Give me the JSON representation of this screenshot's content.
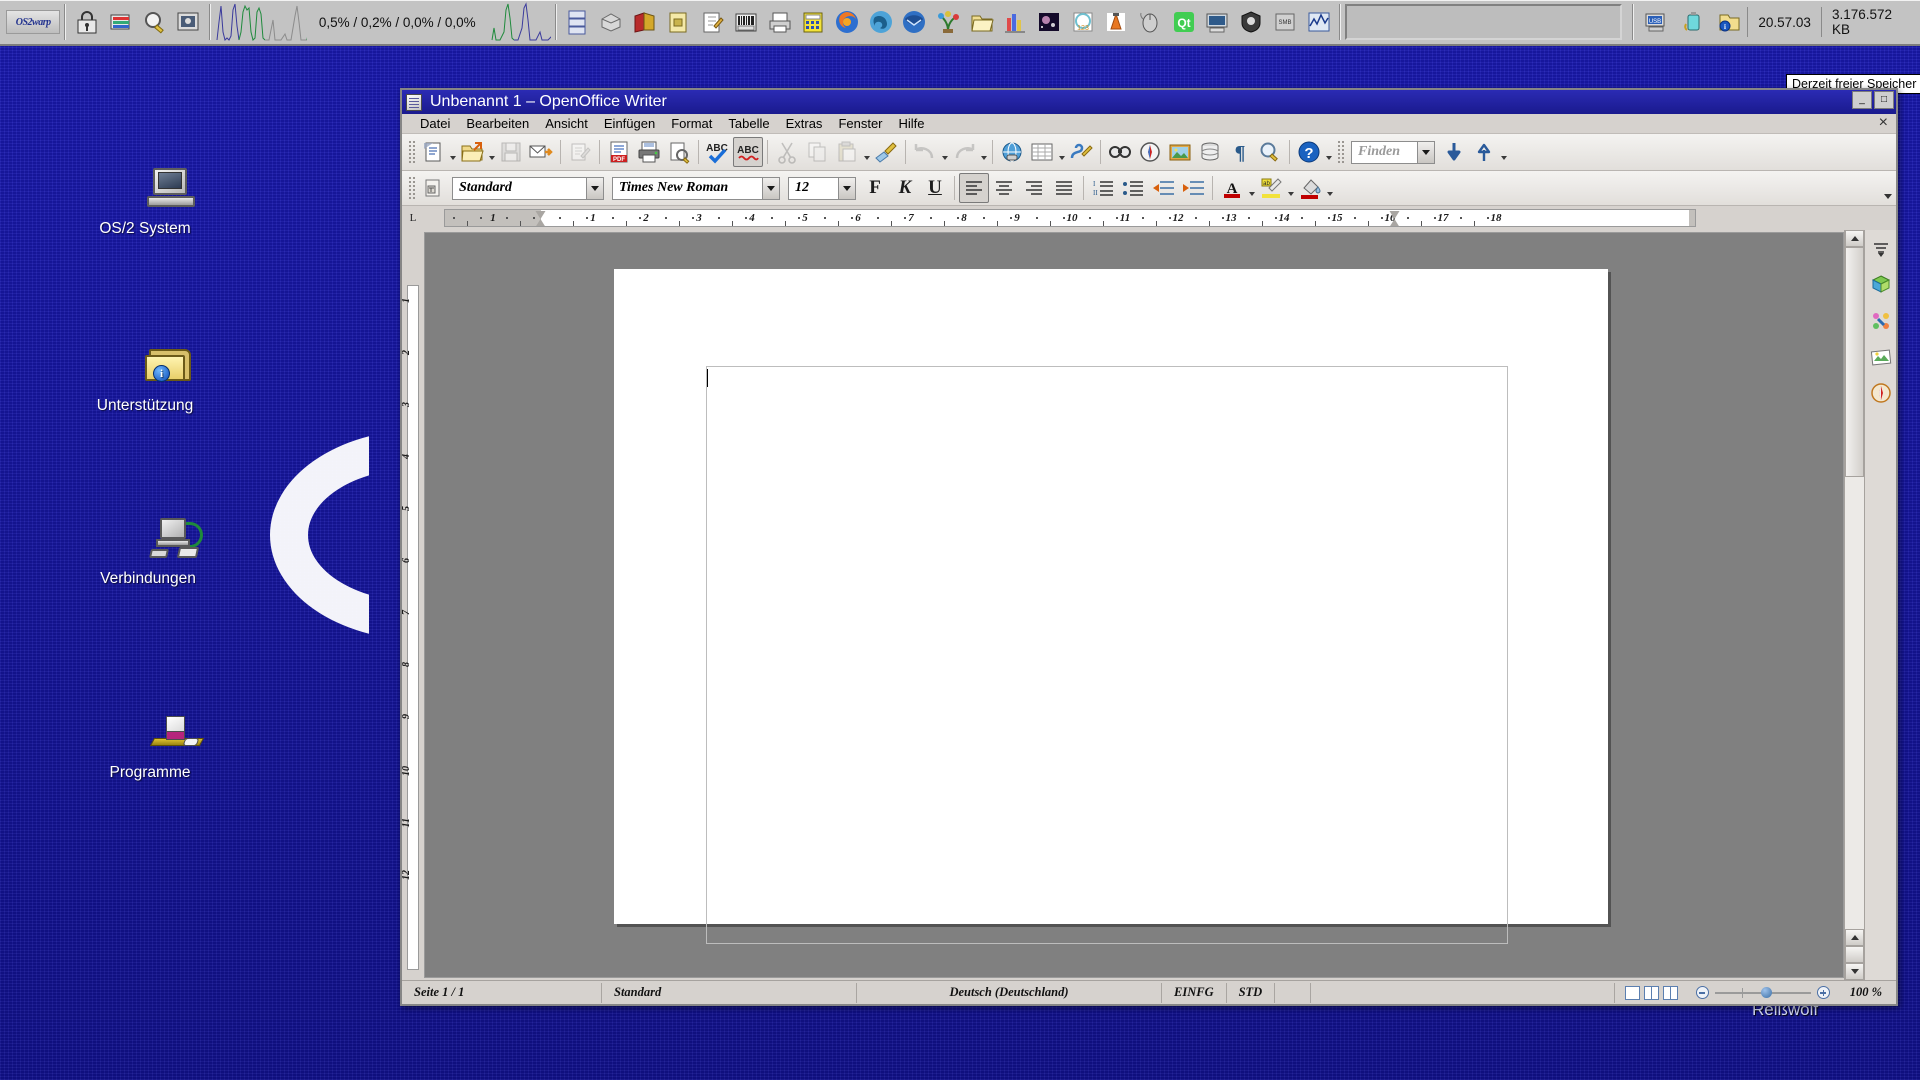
{
  "desktop": {
    "icons": [
      {
        "label": "OS/2 System",
        "icon": "computer-icon"
      },
      {
        "label": "Unterstützung",
        "icon": "folder-info-icon"
      },
      {
        "label": "Verbindungen",
        "icon": "network-icon"
      },
      {
        "label": "Programme",
        "icon": "programs-icon"
      }
    ],
    "watermark_text": "Reißwolf"
  },
  "xcenter": {
    "os2_logo": "OS2warp",
    "cpu_load": "0,5% / 0,2% / 0,0% / 0,0%",
    "clock": "20.57.03",
    "free_memory": "3.176.572 KB",
    "tooltip": "Derzeit freier Speicher",
    "left_buttons": [
      {
        "name": "lock-icon",
        "title": "Sperren"
      },
      {
        "name": "window-list-icon",
        "title": "Fensterliste"
      },
      {
        "name": "find-icon",
        "title": "Suchen"
      },
      {
        "name": "desktop-icon",
        "title": "Arbeitsoberfläche"
      }
    ],
    "launch_buttons": [
      {
        "name": "drives-icon"
      },
      {
        "name": "harddisk-icon"
      },
      {
        "name": "books-icon"
      },
      {
        "name": "notebook-icon"
      },
      {
        "name": "editor-icon"
      },
      {
        "name": "keyboard-icon"
      },
      {
        "name": "printer-icon"
      },
      {
        "name": "calculator-icon"
      },
      {
        "name": "firefox-icon"
      },
      {
        "name": "seamonkey-icon"
      },
      {
        "name": "thunderbird-icon"
      },
      {
        "name": "plant-icon"
      },
      {
        "name": "folder-open-icon"
      },
      {
        "name": "city-icon"
      },
      {
        "name": "space-icon"
      },
      {
        "name": "numbers-icon"
      },
      {
        "name": "vlc-icon"
      },
      {
        "name": "mouse-icon"
      },
      {
        "name": "qt-icon"
      },
      {
        "name": "monitor-icon"
      },
      {
        "name": "shield-icon"
      },
      {
        "name": "samba-icon"
      },
      {
        "name": "intel-icon"
      }
    ],
    "tray_buttons": [
      {
        "name": "usb-icon"
      },
      {
        "name": "battery-icon"
      },
      {
        "name": "folder-info-tray-icon"
      }
    ]
  },
  "writer": {
    "title": "Unbenannt 1 – OpenOffice Writer",
    "window_buttons": [
      "_",
      "□",
      "×"
    ],
    "menu_close": "×",
    "menu": [
      {
        "label": "Datei",
        "accel": "D"
      },
      {
        "label": "Bearbeiten",
        "accel": "B"
      },
      {
        "label": "Ansicht",
        "accel": "A"
      },
      {
        "label": "Einfügen",
        "accel": "E"
      },
      {
        "label": "Format",
        "accel": "F"
      },
      {
        "label": "Tabelle",
        "accel": "T"
      },
      {
        "label": "Extras",
        "accel": "x"
      },
      {
        "label": "Fenster",
        "accel": "s"
      },
      {
        "label": "Hilfe",
        "accel": "H"
      }
    ],
    "standard_toolbar": [
      {
        "name": "new-document-button",
        "label": "Neu",
        "dropdown": true,
        "disabled": false
      },
      {
        "name": "open-document-button",
        "label": "Öffnen",
        "dropdown": true,
        "disabled": false
      },
      {
        "name": "save-button",
        "label": "Speichern",
        "disabled": true
      },
      {
        "name": "send-email-button",
        "label": "Direkt als E-Mail senden",
        "disabled": false
      },
      {
        "name": "edit-file-button",
        "label": "Datei bearbeiten",
        "disabled": true
      },
      {
        "name": "export-pdf-button",
        "label": "Direktes Exportieren als PDF",
        "disabled": false
      },
      {
        "name": "print-button",
        "label": "Datei direkt drucken",
        "disabled": false
      },
      {
        "name": "print-preview-button",
        "label": "Seitenansicht",
        "disabled": false
      },
      {
        "name": "spelling-button",
        "label": "Rechtschreibung",
        "disabled": false
      },
      {
        "name": "autospellcheck-button",
        "label": "AutoKorrektur",
        "selected": true
      },
      {
        "name": "cut-button",
        "label": "Ausschneiden",
        "disabled": true
      },
      {
        "name": "copy-button",
        "label": "Kopieren",
        "disabled": true
      },
      {
        "name": "paste-button",
        "label": "Einfügen",
        "dropdown": true,
        "disabled": true
      },
      {
        "name": "clone-formatting-button",
        "label": "Format übertragen",
        "disabled": false
      },
      {
        "name": "undo-button",
        "label": "Rückgängig",
        "dropdown": true,
        "disabled": true
      },
      {
        "name": "redo-button",
        "label": "Wiederherstellen",
        "dropdown": true,
        "disabled": true
      },
      {
        "name": "hyperlink-button",
        "label": "Hyperlink",
        "disabled": false
      },
      {
        "name": "insert-table-button",
        "label": "Tabelle",
        "dropdown": true,
        "disabled": false
      },
      {
        "name": "show-draw-functions-button",
        "label": "Zeichnungsfunktionen",
        "disabled": false
      },
      {
        "name": "find-replace-button",
        "label": "Suchen & Ersetzen",
        "disabled": false
      },
      {
        "name": "navigator-button",
        "label": "Navigator",
        "disabled": false
      },
      {
        "name": "gallery-button",
        "label": "Gallery",
        "disabled": false
      },
      {
        "name": "data-sources-button",
        "label": "Datenquellen",
        "disabled": false
      },
      {
        "name": "formatting-marks-button",
        "label": "Formatierungszeichen",
        "disabled": false
      },
      {
        "name": "zoom-button",
        "label": "Maßstab",
        "disabled": false
      },
      {
        "name": "help-button",
        "label": "OpenOffice Hilfe",
        "dropdown": true,
        "disabled": false
      }
    ],
    "find_toolbar": {
      "placeholder": "Finden",
      "value": "",
      "find_next": "Abwärts suchen",
      "find_prev": "Aufwärts suchen"
    },
    "formatting_toolbar": {
      "paragraph_style": "Standard",
      "font_name": "Times New Roman",
      "font_size": "12",
      "bold_label": "F",
      "italic_label": "K",
      "underline_label": "U",
      "align_buttons": [
        "Linksbündig",
        "Zentriert",
        "Rechtsbündig",
        "Blocksatz"
      ],
      "active_align": 0,
      "list_buttons": [
        "Nummerierte Liste",
        "Liste"
      ],
      "indent_buttons": [
        "Einzug verkleinern",
        "Einzug vergrößern"
      ],
      "color_buttons": [
        "Schriftfarbe",
        "Zeichenhintergrund",
        "Hintergrundfarbe"
      ]
    },
    "ruler": {
      "unit_numbers": [
        "1",
        "1",
        "2",
        "3",
        "4",
        "5",
        "6",
        "7",
        "8",
        "9",
        "10",
        "11",
        "12",
        "13",
        "14",
        "15",
        "16",
        "17",
        "18"
      ]
    },
    "vruler_numbers": [
      "1",
      "2",
      "3",
      "4",
      "5",
      "6",
      "7",
      "8",
      "9",
      "10",
      "11",
      "12"
    ],
    "statusbar": {
      "page": "Seite 1 / 1",
      "style": "Standard",
      "language": "Deutsch (Deutschland)",
      "insert_mode": "EINFG",
      "selection_mode": "STD",
      "modified": "",
      "zoom": "100 %",
      "view_layouts": [
        "Einzelne Seite",
        "Mehrere Seiten",
        "Buchansicht"
      ],
      "zoom_out": "Verkleinern",
      "zoom_in": "Vergrößern"
    },
    "sidebar_icons": [
      {
        "name": "sidebar-menu-icon"
      },
      {
        "name": "gallery-sidebar-icon"
      },
      {
        "name": "styles-sidebar-icon"
      },
      {
        "name": "image-sidebar-icon"
      },
      {
        "name": "navigator-sidebar-icon"
      }
    ]
  },
  "colors": {
    "desktop_blue": "#1414a8",
    "titlebar_blue": "#2b2bb4",
    "toolbar_grey": "#d6d2ce",
    "accent_orange": "#e08a1e"
  }
}
